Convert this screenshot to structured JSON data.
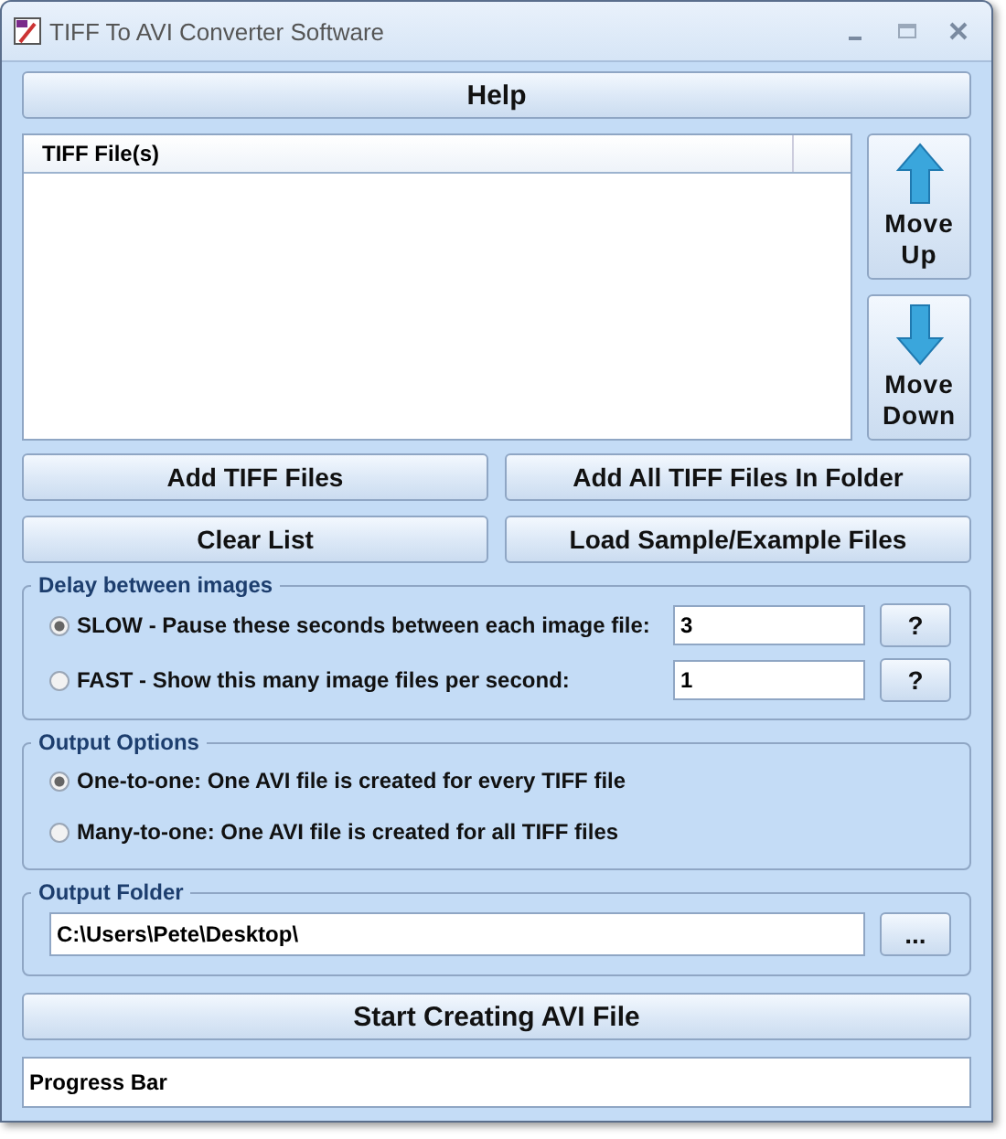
{
  "window": {
    "title": "TIFF To AVI Converter Software"
  },
  "help_button": "Help",
  "file_list": {
    "columns": [
      "TIFF File(s)"
    ]
  },
  "move_buttons": [
    {
      "kind": "up",
      "label": "Move Up"
    },
    {
      "kind": "down",
      "label": "Move Down"
    }
  ],
  "action_buttons": [
    "Add TIFF Files",
    "Add All TIFF Files In Folder",
    "Clear List",
    "Load Sample/Example Files"
  ],
  "delay": {
    "title": "Delay between images",
    "options": [
      {
        "label": "SLOW - Pause these seconds between each image file:",
        "selected": true,
        "value": "3",
        "help": "?"
      },
      {
        "label": "FAST - Show this many image files per second:",
        "selected": false,
        "value": "1",
        "help": "?"
      }
    ]
  },
  "output_options": {
    "title": "Output Options",
    "options": [
      {
        "label": "One-to-one: One AVI file is created for every TIFF file",
        "selected": true
      },
      {
        "label": "Many-to-one: One AVI file is created for all TIFF files",
        "selected": false
      }
    ]
  },
  "output_folder": {
    "title": "Output Folder",
    "value": "C:\\Users\\Pete\\Desktop\\",
    "browse": "..."
  },
  "start_button": "Start Creating AVI File",
  "progress": {
    "label": "Progress Bar"
  }
}
